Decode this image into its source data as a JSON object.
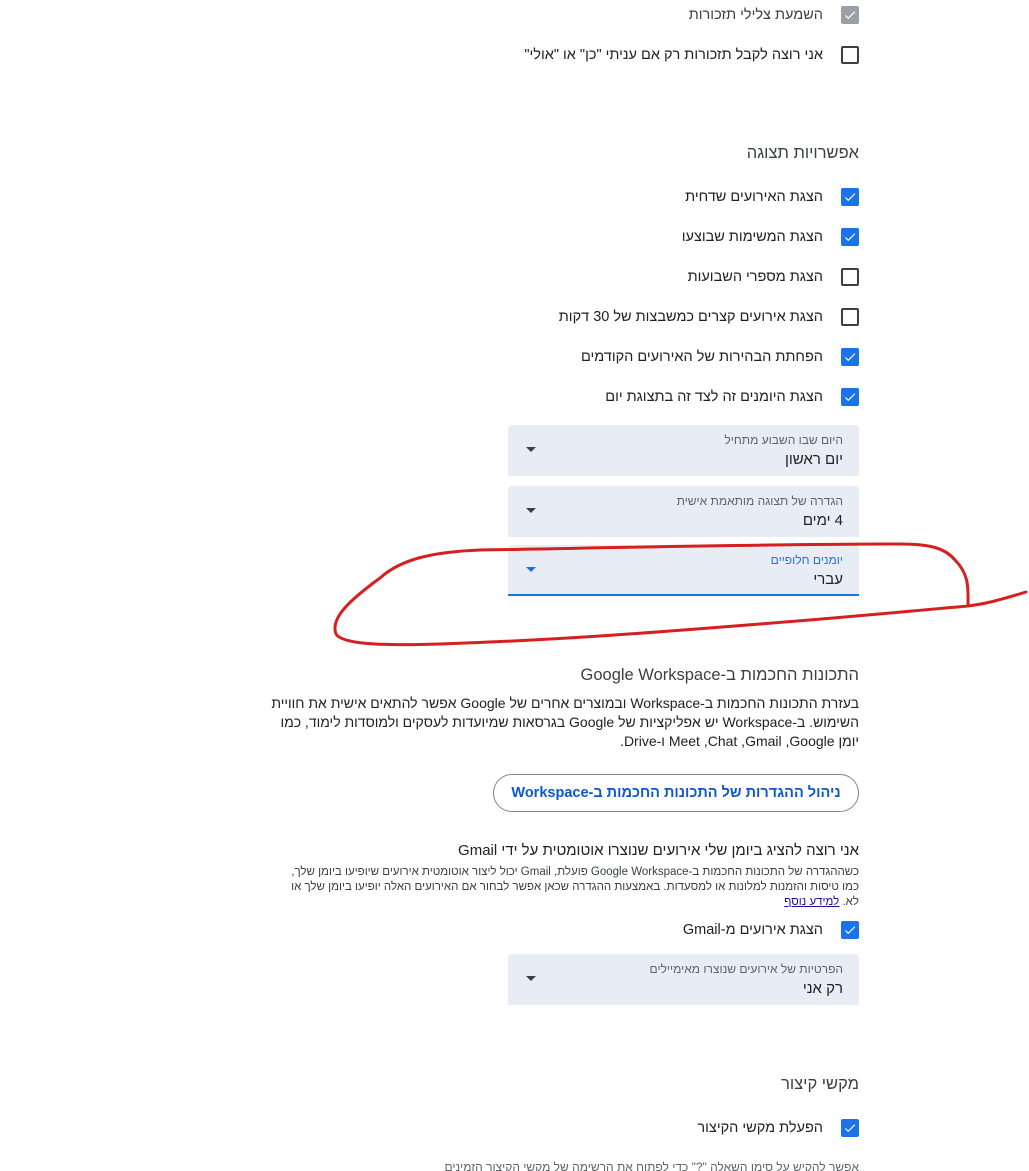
{
  "notifications": {
    "play_sounds": {
      "label": "השמעת צלילי תזכורות",
      "checked": true,
      "disabled": true
    },
    "only_if_yes": {
      "label": "אני רוצה לקבל תזכורות רק אם עניתי \"כן\" או \"אולי\"",
      "checked": false
    }
  },
  "view_options": {
    "title": "אפשרויות תצוגה",
    "checkboxes": [
      {
        "label": "הצגת האירועים שדחית",
        "checked": true
      },
      {
        "label": "הצגת המשימות שבוצעו",
        "checked": true
      },
      {
        "label": "הצגת מספרי השבועות",
        "checked": false
      },
      {
        "label": "הצגת אירועים קצרים כמשבצות של 30 דקות",
        "checked": false
      },
      {
        "label": "הפחתת הבהירות של האירועים הקודמים",
        "checked": true
      },
      {
        "label": "הצגת היומנים זה לצד זה בתצוגת יום",
        "checked": true
      }
    ],
    "week_start": {
      "label": "היום שבו השבוע מתחיל",
      "value": "יום ראשון"
    },
    "custom_view": {
      "label": "הגדרה של תצוגה מותאמת אישית",
      "value": "4 ימים"
    },
    "alt_calendar": {
      "label": "יומנים חלופיים",
      "value": "עברי"
    }
  },
  "smart_features": {
    "title": "התכונות החכמות ב-Google Workspace",
    "description_lines": [
      "בעזרת התכונות החכמות ב-Workspace ובמוצרים אחרים של Google אפשר להתאים אישית את חוויית",
      "השימוש. ב-Workspace יש אפליקציות של Google בגרסאות שמיועדות לעסקים ולמוסדות לימוד, כמו",
      "יומן Google‏, Gmail‏, Chat‏, Meet ו-Drive."
    ],
    "manage_button": "ניהול ההגדרות של התכונות החכמות ב-Workspace",
    "gmail_heading": "אני רוצה להציג ביומן שלי אירועים שנוצרו אוטומטית על ידי Gmail",
    "gmail_description_lines": [
      "כשההגדרה של התכונות החכמות ב-Google Workspace פועלת, Gmail יכול ליצור אוטומטית אירועים שיופיעו ביומן שלך,",
      "כמו טיסות והזמנות למלונות או למסעדות. באמצעות ההגדרה שכאן אפשר לבחור אם האירועים האלה יופיעו ביומן שלך או",
      "לא."
    ],
    "learn_more": "למידע נוסף",
    "show_gmail_events": {
      "label": "הצגת אירועים מ-Gmail",
      "checked": true
    },
    "gmail_privacy": {
      "label": "הפרטיות של אירועים שנוצרו מאימיילים",
      "value": "רק אני"
    }
  },
  "shortcuts": {
    "title": "מקשי קיצור",
    "enable": {
      "label": "הפעלת מקשי הקיצור",
      "checked": true
    },
    "hint_partial": "אפשר להקיש על סימן השאלה \"?\" כדי לפתוח את הרשימה של מקשי הקיצור הזמינים"
  },
  "colors": {
    "accent": "#1a73e8",
    "button_text": "#0b57d0",
    "select_bg": "#e8ecf4",
    "annotation_red": "#d61f1f"
  }
}
